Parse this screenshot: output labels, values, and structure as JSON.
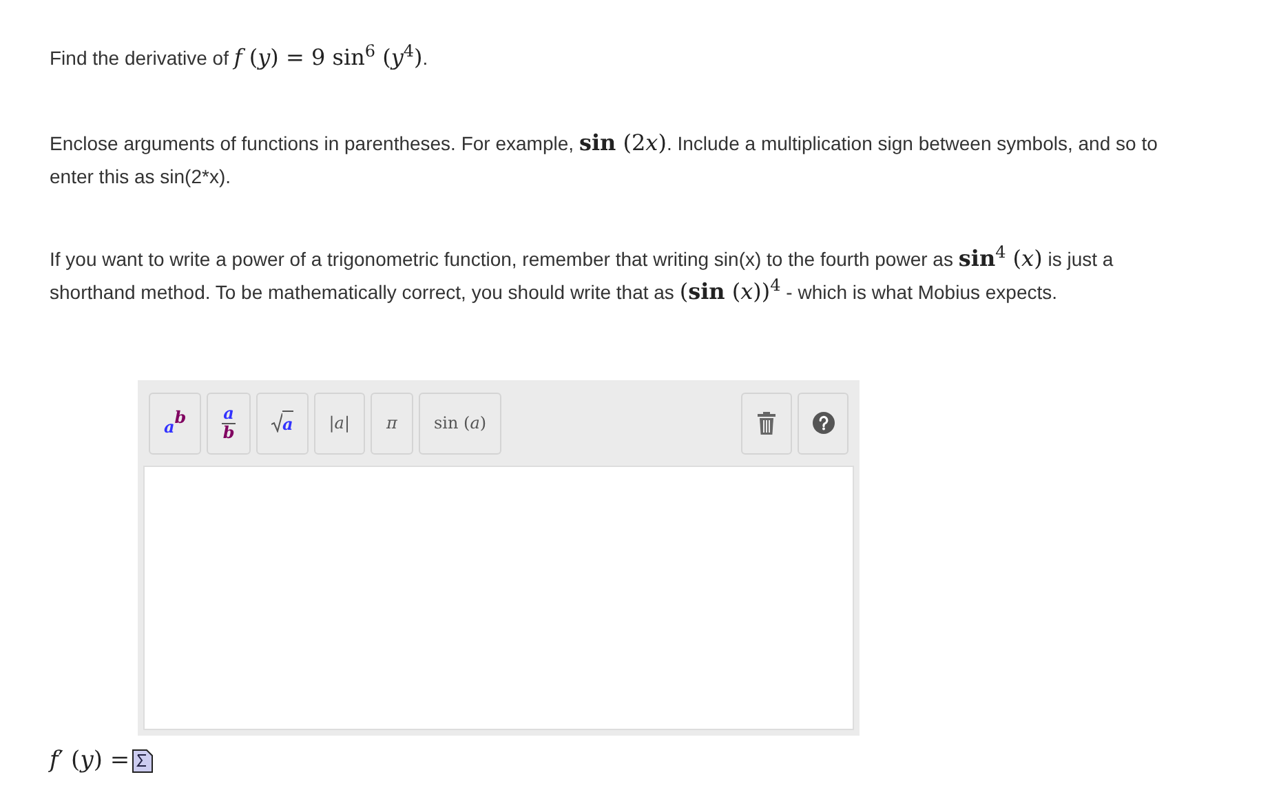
{
  "question": [
    {
      "kind": "text",
      "text": "Find the derivative of "
    },
    {
      "kind": "math",
      "text": "*f* (*y*) = 9 sin$^{6}$ (*y*$^{4}$)"
    },
    {
      "kind": "text",
      "text": "."
    }
  ],
  "hints": [
    [
      {
        "kind": "text",
        "text": "Enclose arguments of functions in parentheses. For example, "
      },
      {
        "kind": "math",
        "text": "**sin** (2"
      },
      {
        "kind": "math",
        "text": "*x*)"
      },
      {
        "kind": "text",
        "text": ". Include a multiplication sign between symbols, and so to enter this as sin(2*x)."
      }
    ],
    [
      {
        "kind": "text",
        "text": "If you want to write a power of a trigonometric function, remember that writing sin(x) to the fourth power as "
      },
      {
        "kind": "math",
        "text": "**sin**$^{4}$ (*x*)"
      },
      {
        "kind": "text",
        "text": " is just a shorthand method. To be mathematically correct, you should write that as "
      },
      {
        "kind": "math",
        "text": "(**sin** (*x*))$^{4}$"
      },
      {
        "kind": "text",
        "text": " - which is what Mobius expects."
      }
    ]
  ],
  "toolbar": [
    {
      "kind": "power",
      "base": "a",
      "exponent": "b"
    },
    {
      "kind": "fraction",
      "numerator": "a",
      "denominator": "b"
    },
    {
      "kind": "sqrt",
      "radicand": "a"
    },
    {
      "kind": "abs",
      "text": "|*a*|"
    },
    {
      "kind": "symbol",
      "text": "π"
    },
    {
      "kind": "function",
      "text": "sin (*a*)"
    }
  ],
  "answer": {
    "label": "*f*′ (*y*) ="
  }
}
